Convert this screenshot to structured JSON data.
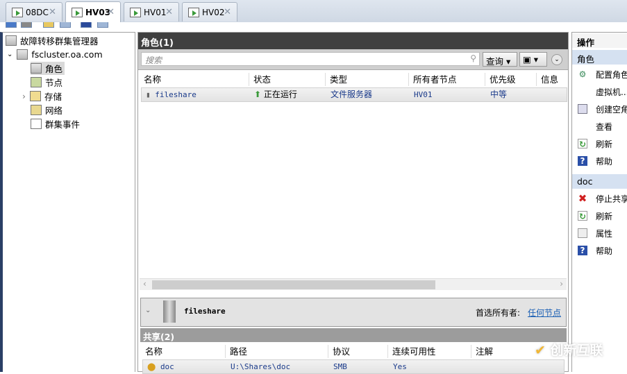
{
  "tabs": [
    {
      "label": "08DC"
    },
    {
      "label": "HV03",
      "active": true
    },
    {
      "label": "HV01"
    },
    {
      "label": "HV02"
    }
  ],
  "tree": {
    "root": "故障转移群集管理器",
    "cluster": "fscluster.oa.com",
    "items": [
      {
        "label": "角色",
        "selected": true
      },
      {
        "label": "节点"
      },
      {
        "label": "存储"
      },
      {
        "label": "网络"
      },
      {
        "label": "群集事件"
      }
    ]
  },
  "roles": {
    "title": "角色(1)",
    "search_placeholder": "搜索",
    "query_label": "查询",
    "columns": [
      "名称",
      "状态",
      "类型",
      "所有者节点",
      "优先级",
      "信息"
    ],
    "rows": [
      {
        "name": "fileshare",
        "status": "正在运行",
        "type": "文件服务器",
        "owner": "HV01",
        "priority": "中等",
        "info": ""
      }
    ]
  },
  "details": {
    "name": "fileshare",
    "preferred_owner_label": "首选所有者:",
    "preferred_owner_link": "任何节点",
    "shares_title": "共享(2)",
    "share_columns": [
      "名称",
      "路径",
      "协议",
      "连续可用性",
      "注解"
    ],
    "shares": [
      {
        "name": "doc",
        "path": "U:\\Shares\\doc",
        "protocol": "SMB",
        "ca": "Yes",
        "note": ""
      }
    ]
  },
  "actions": {
    "title": "操作",
    "group1": "角色",
    "group1_items": [
      {
        "label": "配置角色...",
        "icon": "configure-icon"
      },
      {
        "label": "虚拟机...",
        "icon": ""
      },
      {
        "label": "创建空角色",
        "icon": "create-icon"
      },
      {
        "label": "查看",
        "icon": ""
      },
      {
        "label": "刷新",
        "icon": "refresh-icon"
      },
      {
        "label": "帮助",
        "icon": "help-icon"
      }
    ],
    "group2": "doc",
    "group2_items": [
      {
        "label": "停止共享",
        "icon": "stop-icon"
      },
      {
        "label": "刷新",
        "icon": "refresh-icon"
      },
      {
        "label": "属性",
        "icon": "properties-icon"
      },
      {
        "label": "帮助",
        "icon": "help-icon"
      }
    ]
  },
  "watermark": "创新互联"
}
